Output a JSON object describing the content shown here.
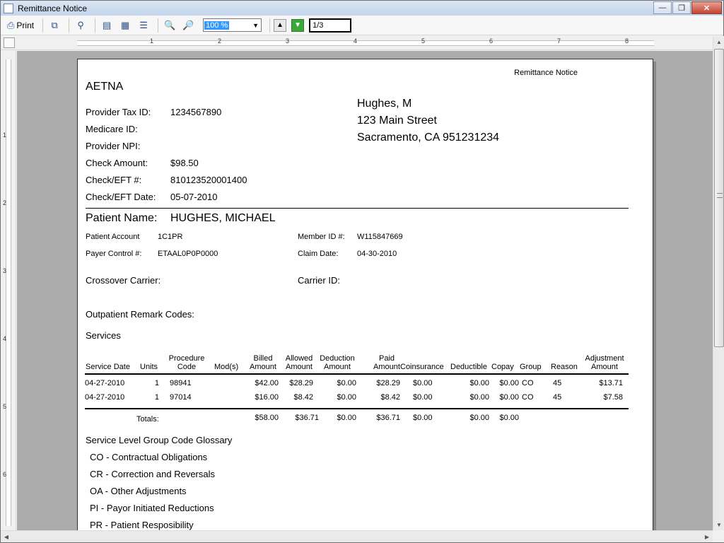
{
  "window": {
    "title": "Remittance Notice",
    "minimize_label": "—",
    "maximize_label": "❐",
    "close_label": "✕"
  },
  "toolbar": {
    "print_label": "Print",
    "zoom_value": "100 %",
    "page_indicator": "1/3"
  },
  "ruler": {
    "horizontal_marks": [
      "1",
      "2",
      "3",
      "4",
      "5",
      "6",
      "7",
      "8"
    ],
    "vertical_marks": [
      "1",
      "2",
      "3",
      "4",
      "5",
      "6"
    ]
  },
  "document": {
    "heading": "Remittance Notice",
    "payer_name": "AETNA",
    "provider_fields": [
      {
        "label": "Provider Tax ID:",
        "value": "1234567890"
      },
      {
        "label": "Medicare ID:",
        "value": ""
      },
      {
        "label": "Provider NPI:",
        "value": ""
      },
      {
        "label": "Check Amount:",
        "value": "$98.50"
      },
      {
        "label": "Check/EFT #:",
        "value": "810123520001400"
      },
      {
        "label": "Check/EFT Date:",
        "value": "05-07-2010"
      }
    ],
    "address": [
      "Hughes, M",
      "123 Main Street",
      "Sacramento, CA 951231234"
    ],
    "patient": {
      "label": "Patient Name:",
      "name": "HUGHES, MICHAEL",
      "account_label": "Patient Account",
      "account_value": "1C1PR",
      "member_id_label": "Member ID #:",
      "member_id_value": "W115847669",
      "payer_control_label": "Payer Control #:",
      "payer_control_value": "ETAAL0P0P0000",
      "claim_date_label": "Claim Date:",
      "claim_date_value": "04-30-2010",
      "crossover_label": "Crossover Carrier:",
      "carrier_id_label": "Carrier ID:"
    },
    "outpatient_label": "Outpatient Remark Codes:",
    "services_label": "Services",
    "services": {
      "headers": {
        "service_date": "Service Date",
        "units": "Units",
        "procedure_l1": "Procedure",
        "procedure_l2": "Code",
        "mods": "Mod(s)",
        "billed_l1": "Billed",
        "billed_l2": "Amount",
        "allowed_l1": "Allowed",
        "allowed_l2": "Amount",
        "deduction_l1": "Deduction",
        "deduction_l2": "Amount",
        "paid_l1": "Paid",
        "paid_l2": "Amount",
        "coinsurance": "Coinsurance",
        "deductible": "Deductible",
        "copay": "Copay",
        "group": "Group",
        "reason": "Reason",
        "adjustment_l1": "Adjustment",
        "adjustment_l2": "Amount"
      },
      "rows": [
        {
          "service_date": "04-27-2010",
          "units": "1",
          "procedure": "98941",
          "mods": "",
          "billed": "$42.00",
          "allowed": "$28.29",
          "deduction": "$0.00",
          "paid": "$28.29",
          "coinsurance": "$0.00",
          "deductible": "$0.00",
          "copay": "$0.00",
          "group": "CO",
          "reason": "45",
          "adjustment": "$13.71"
        },
        {
          "service_date": "04-27-2010",
          "units": "1",
          "procedure": "97014",
          "mods": "",
          "billed": "$16.00",
          "allowed": "$8.42",
          "deduction": "$0.00",
          "paid": "$8.42",
          "coinsurance": "$0.00",
          "deductible": "$0.00",
          "copay": "$0.00",
          "group": "CO",
          "reason": "45",
          "adjustment": "$7.58"
        }
      ],
      "totals": {
        "label": "Totals:",
        "billed": "$58.00",
        "allowed": "$36.71",
        "deduction": "$0.00",
        "paid": "$36.71",
        "coinsurance": "$0.00",
        "deductible": "$0.00",
        "copay": "$0.00"
      }
    },
    "glossary_title": "Service Level Group Code Glossary",
    "glossary": [
      "CO - Contractual Obligations",
      "CR - Correction and Reversals",
      "OA - Other Adjustments",
      "PI - Payor Initiated Reductions",
      "PR - Patient Resposibility"
    ]
  }
}
